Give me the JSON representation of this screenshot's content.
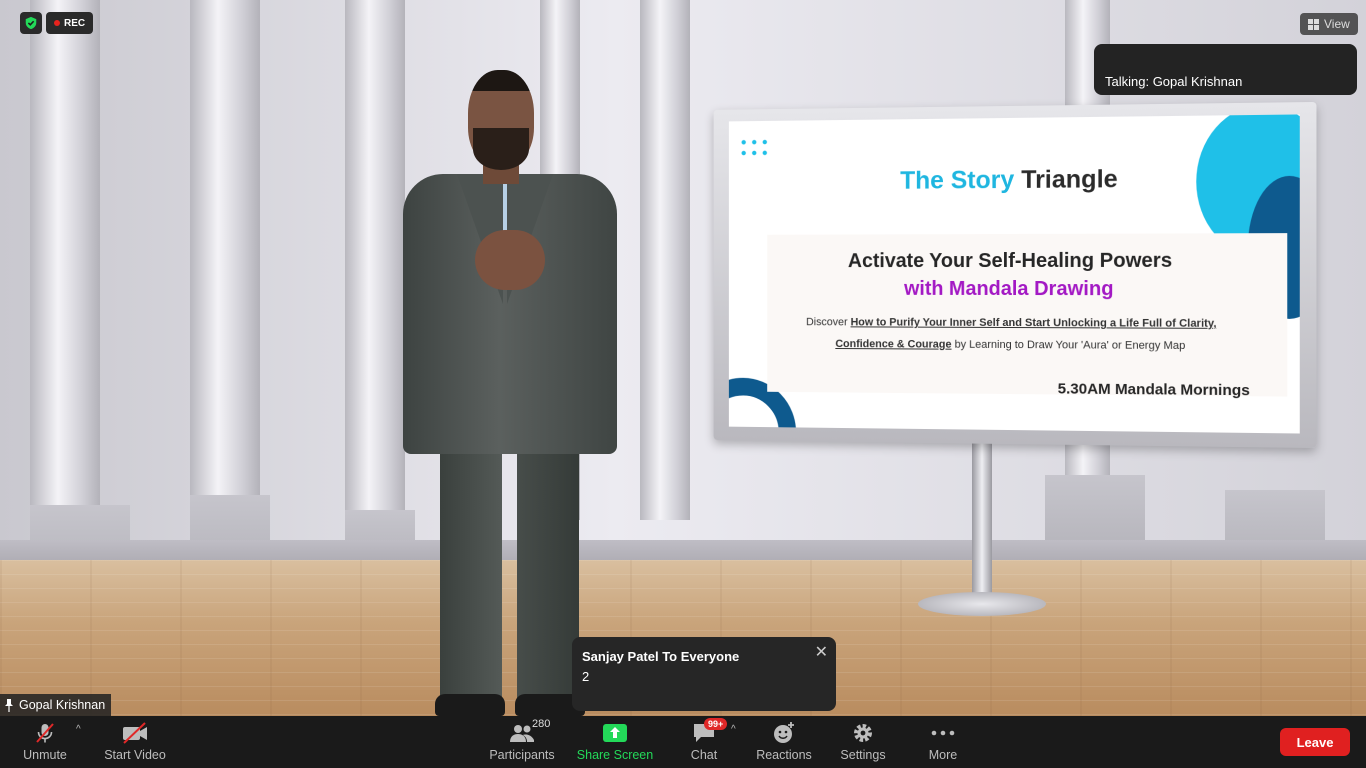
{
  "recording": {
    "label": "REC"
  },
  "view_button": {
    "label": "View"
  },
  "talking_indicator": {
    "text": "Talking: Gopal Krishnan"
  },
  "participant_name": "Gopal Krishnan",
  "slide": {
    "title_part1": "The Story",
    "title_part2": "Triangle",
    "heading_line1": "Activate Your Self-Healing Powers",
    "heading_line2": "with Mandala Drawing",
    "body_prefix": "Discover",
    "body_link_1": "How to Purify Your Inner Self and Start Unlocking a Life Full of Clarity,",
    "body_link_2": "Confidence & Courage",
    "body_suffix": "by Learning to Draw Your 'Aura' or Energy Map",
    "footer": "5.30AM Mandala Mornings"
  },
  "chat_notification": {
    "sender": "Sanjay Patel To Everyone",
    "message": "2",
    "close": "✕"
  },
  "toolbar": {
    "unmute_label": "Unmute",
    "start_video_label": "Start Video",
    "participants_label": "Participants",
    "participants_count": "280",
    "share_screen_label": "Share Screen",
    "chat_label": "Chat",
    "chat_badge": "99+",
    "reactions_label": "Reactions",
    "settings_label": "Settings",
    "more_label": "More",
    "leave_label": "Leave"
  },
  "colors": {
    "accent_green": "#23d959",
    "leave_red": "#e02020",
    "slide_cyan": "#1fb6e0",
    "slide_purple": "#a319c4"
  },
  "icons": [
    "shield-icon",
    "record-dot-icon",
    "view-grid-icon",
    "pin-icon",
    "muted-mic-icon",
    "video-off-icon",
    "participants-icon",
    "share-screen-icon",
    "chat-icon",
    "reactions-icon",
    "settings-icon",
    "more-icon",
    "close-icon",
    "caret-up-icon"
  ]
}
